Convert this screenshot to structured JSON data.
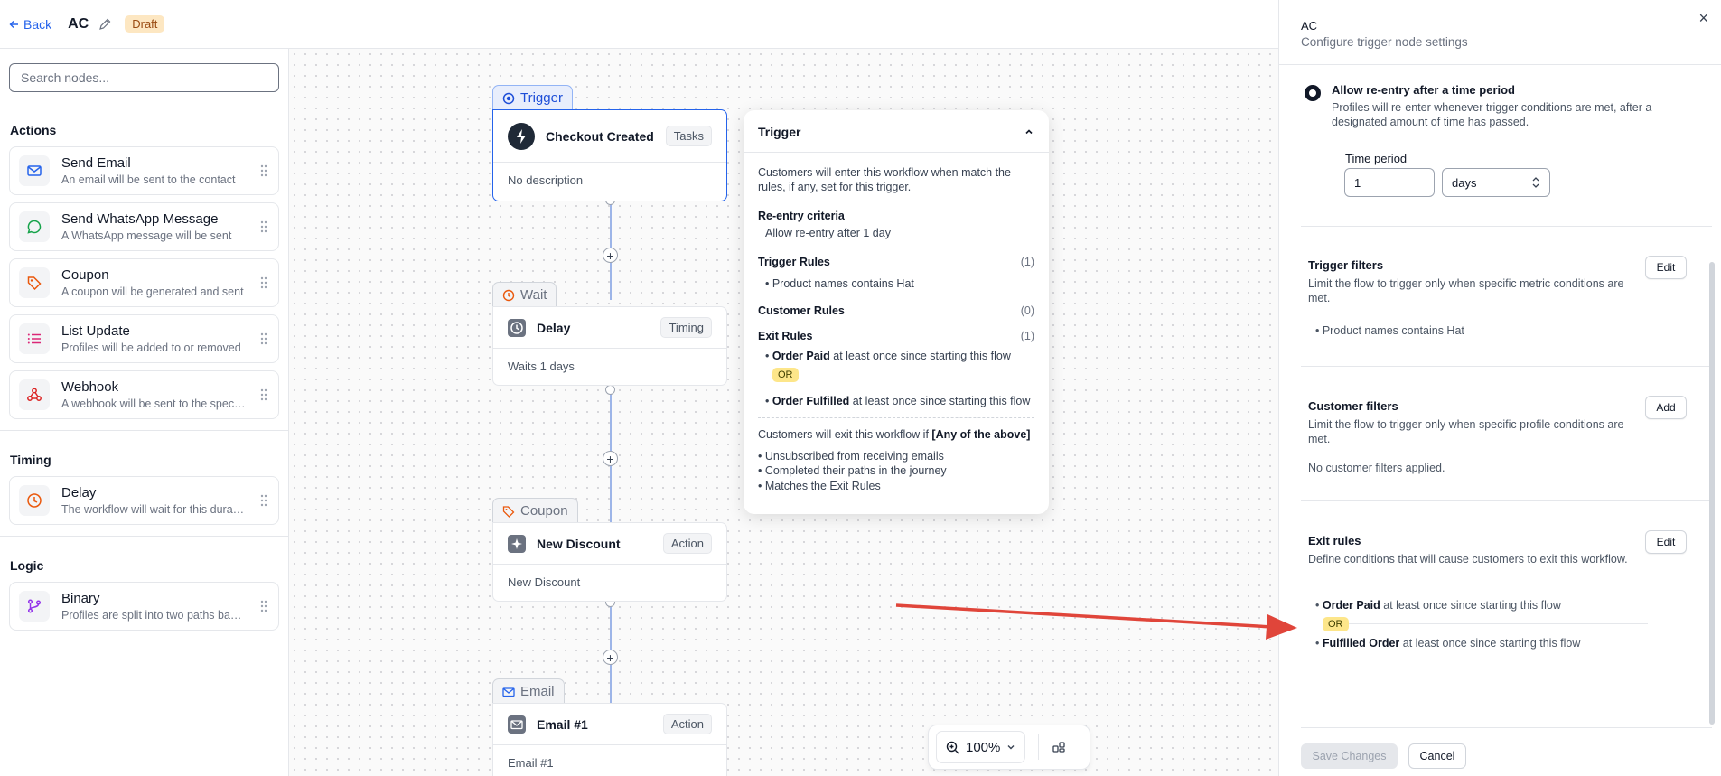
{
  "header": {
    "back_label": "Back",
    "title": "AC",
    "status": "Draft"
  },
  "sidebar": {
    "search_placeholder": "Search nodes...",
    "sections": [
      {
        "title": "Actions",
        "items": [
          {
            "name": "Send Email",
            "desc": "An email will be sent to the contact",
            "icon": "mail-icon",
            "color": "#2563eb"
          },
          {
            "name": "Send WhatsApp Message",
            "desc": "A WhatsApp message will be sent",
            "icon": "message-circle-icon",
            "color": "#16a34a"
          },
          {
            "name": "Coupon",
            "desc": "A coupon will be generated and sent",
            "icon": "tag-icon",
            "color": "#ea580c"
          },
          {
            "name": "List Update",
            "desc": "Profiles will be added to or removed",
            "icon": "list-icon",
            "color": "#db2777"
          },
          {
            "name": "Webhook",
            "desc": "A webhook will be sent to the specified",
            "icon": "webhook-icon",
            "color": "#dc2626"
          }
        ]
      },
      {
        "title": "Timing",
        "items": [
          {
            "name": "Delay",
            "desc": "The workflow will wait for this duration",
            "icon": "clock-icon",
            "color": "#ea580c"
          }
        ]
      },
      {
        "title": "Logic",
        "items": [
          {
            "name": "Binary",
            "desc": "Profiles are split into two paths based",
            "icon": "git-branch-icon",
            "color": "#9333ea"
          }
        ]
      }
    ]
  },
  "canvas": {
    "nodes": [
      {
        "tab": "Trigger",
        "title": "Checkout Created",
        "badge": "Tasks",
        "desc": "No description"
      },
      {
        "tab": "Wait",
        "title": "Delay",
        "badge": "Timing",
        "desc": "Waits 1 days"
      },
      {
        "tab": "Coupon",
        "title": "New Discount",
        "badge": "Action",
        "desc": "New Discount"
      },
      {
        "tab": "Email",
        "title": "Email #1",
        "badge": "Action",
        "desc": "Email #1"
      }
    ],
    "popover": {
      "title": "Trigger",
      "intro": "Customers will enter this workflow when match the rules, if any, set for this trigger.",
      "reentry_label": "Re-entry criteria",
      "reentry_value": "Allow re-entry after 1 day",
      "trigger_rules_label": "Trigger Rules",
      "trigger_rules_count": "(1)",
      "trigger_rule": "• Product names contains Hat",
      "customer_rules_label": "Customer Rules",
      "customer_rules_count": "(0)",
      "exit_rules_label": "Exit Rules",
      "exit_rules_count": "(1)",
      "exit_rule_1_bold": "Order Paid",
      "exit_rule_1_rest": " at least once since starting this flow",
      "or_label": "OR",
      "exit_rule_2_bold": "Order Fulfilled",
      "exit_rule_2_rest": " at least once since starting this flow",
      "exit_intro": "Customers will exit this workflow if",
      "exit_intro_bold": "[Any of the above]",
      "exit_conditions": [
        "Unsubscribed from receiving emails",
        "Completed their paths in the journey",
        "Matches the Exit Rules"
      ]
    },
    "zoom": "100%"
  },
  "panel": {
    "title": "AC",
    "subtitle": "Configure trigger node settings",
    "reentry_option_title": "Allow re-entry after a time period",
    "reentry_option_desc": "Profiles will re-enter whenever trigger conditions are met, after a designated amount of time has passed.",
    "time_period_label": "Time period",
    "time_period_value": "1",
    "time_unit": "days",
    "trigger_filters": {
      "title": "Trigger filters",
      "desc": "Limit the flow to trigger only when specific metric conditions are met.",
      "rule": "• Product names contains Hat",
      "button": "Edit"
    },
    "customer_filters": {
      "title": "Customer filters",
      "desc": "Limit the flow to trigger only when specific profile conditions are met.",
      "empty": "No customer filters applied.",
      "button": "Add"
    },
    "exit_rules": {
      "title": "Exit rules",
      "desc": "Define conditions that will cause customers to exit this workflow.",
      "rule_1_bold": "Order Paid",
      "rule_1_rest": " at least once since starting this flow",
      "or_label": "OR",
      "rule_2_bold": "Fulfilled Order",
      "rule_2_rest": " at least once since starting this flow",
      "button": "Edit"
    },
    "save_label": "Save Changes",
    "cancel_label": "Cancel"
  },
  "colors": {
    "accent": "#2563eb",
    "annotation_arrow": "#e0453a",
    "or_pill": "#fde68a",
    "draft_badge": "#fde7c2"
  }
}
